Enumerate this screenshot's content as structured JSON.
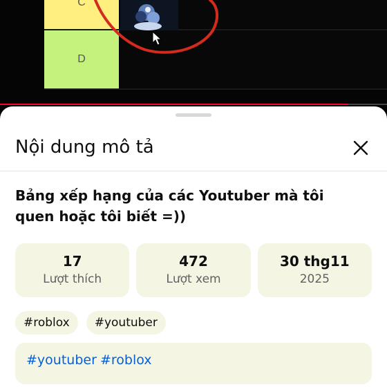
{
  "video": {
    "tier_list": {
      "rows": [
        {
          "label": "C",
          "color": "#ffef7e"
        },
        {
          "label": "D",
          "color": "#c3f27d"
        }
      ]
    },
    "progress_fraction": 0.9,
    "progress_color": "#ff0033",
    "annotation_color": "#d42b1e"
  },
  "sheet": {
    "title": "Nội dung mô tả",
    "close_icon": "close-icon",
    "video_title": "Bảng xếp hạng của các Youtuber mà tôi quen hoặc tôi biết =))",
    "stats": [
      {
        "value": "17",
        "label": "Lượt thích"
      },
      {
        "value": "472",
        "label": "Lượt xem"
      },
      {
        "value": "30 thg11",
        "label": "2025"
      }
    ],
    "tags": [
      "#roblox",
      "#youtuber"
    ],
    "description_tags": [
      "#youtuber",
      "#roblox"
    ]
  }
}
